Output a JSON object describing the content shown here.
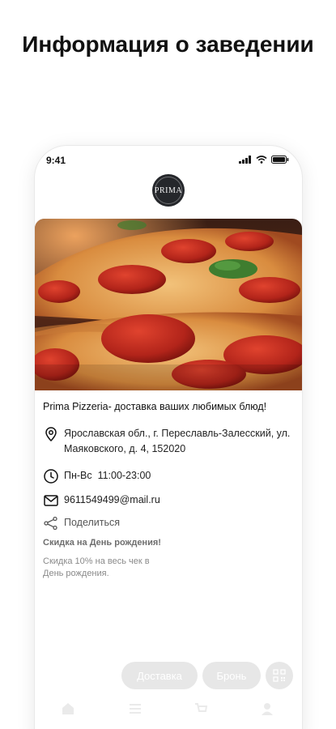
{
  "headline": "Информация о заведении",
  "status_bar": {
    "time": "9:41"
  },
  "logo": {
    "text": "PRIMA"
  },
  "venue": {
    "tagline": "Prima Pizzeria- доставка ваших любимых блюд!",
    "address": "Ярославская обл., г. Переславль-Залесский, ул. Маяковского, д. 4, 152020",
    "hours": "Пн-Вс  11:00-23:00",
    "email": "9611549499@mail.ru",
    "share_label": "Поделиться"
  },
  "promo": {
    "title": "Скидка на День рождения!",
    "description": "Скидка 10% на весь чек в День рождения."
  },
  "actions": {
    "delivery_label": "Доставка",
    "booking_label": "Бронь"
  },
  "icons": {
    "address": "map-pin-icon",
    "hours": "clock-icon",
    "email": "mail-icon",
    "share": "share-icon",
    "qr": "qr-code-icon"
  },
  "colors": {
    "button_bg": "#e7e7e7",
    "logo_bg": "#25272b",
    "muted_text": "#8a8a8a"
  }
}
